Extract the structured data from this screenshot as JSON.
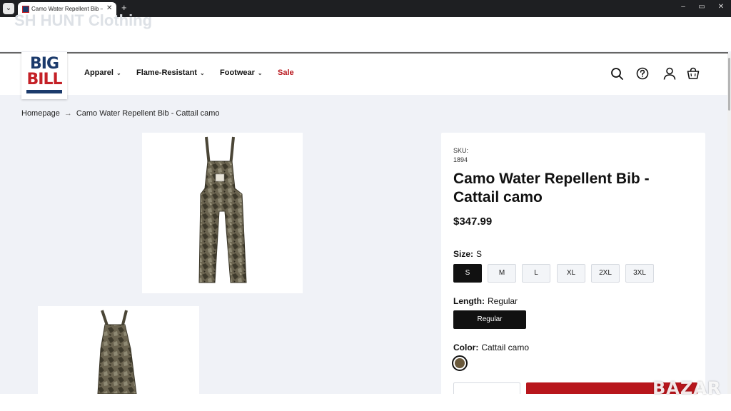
{
  "browser": {
    "tab_title": "Camo Water Repellent Bib – Big Bill",
    "new_tab_glyph": "+",
    "close_glyph": "✕",
    "menu_glyph": "⌄",
    "window_controls": [
      "–",
      "▭",
      "✕"
    ]
  },
  "top_strip": {
    "brand_text": "SH HUNT Clothing"
  },
  "header": {
    "logo": {
      "line1": "BIG",
      "line2": "BILL",
      "colors": {
        "navy": "#1b3a6b",
        "red": "#c42026"
      }
    },
    "nav": [
      {
        "label": "Apparel",
        "has_dropdown": true
      },
      {
        "label": "Flame-Resistant",
        "has_dropdown": true
      },
      {
        "label": "Footwear",
        "has_dropdown": true
      },
      {
        "label": "Sale",
        "has_dropdown": false,
        "color": "#b8161c"
      }
    ],
    "icons": [
      "search-icon",
      "help-icon",
      "account-icon",
      "cart-icon"
    ]
  },
  "breadcrumb": {
    "home": "Homepage",
    "separator": "→",
    "current": "Camo Water Repellent Bib - Cattail camo"
  },
  "product": {
    "sku_label": "SKU:",
    "sku": "1894",
    "title": "Camo Water Repellent Bib - Cattail camo",
    "price": "$347.99",
    "size": {
      "label": "Size:",
      "selected": "S",
      "options": [
        "S",
        "M",
        "L",
        "XL",
        "2XL",
        "3XL"
      ]
    },
    "length": {
      "label": "Length:",
      "selected": "Regular",
      "options": [
        "Regular"
      ]
    },
    "color": {
      "label": "Color:",
      "selected": "Cattail camo",
      "swatch": "#6b5a3c"
    }
  },
  "watermark": "BAZAR",
  "colors": {
    "accent_red": "#b8161c",
    "page_bg": "#f0f2f7",
    "dark": "#111111"
  }
}
